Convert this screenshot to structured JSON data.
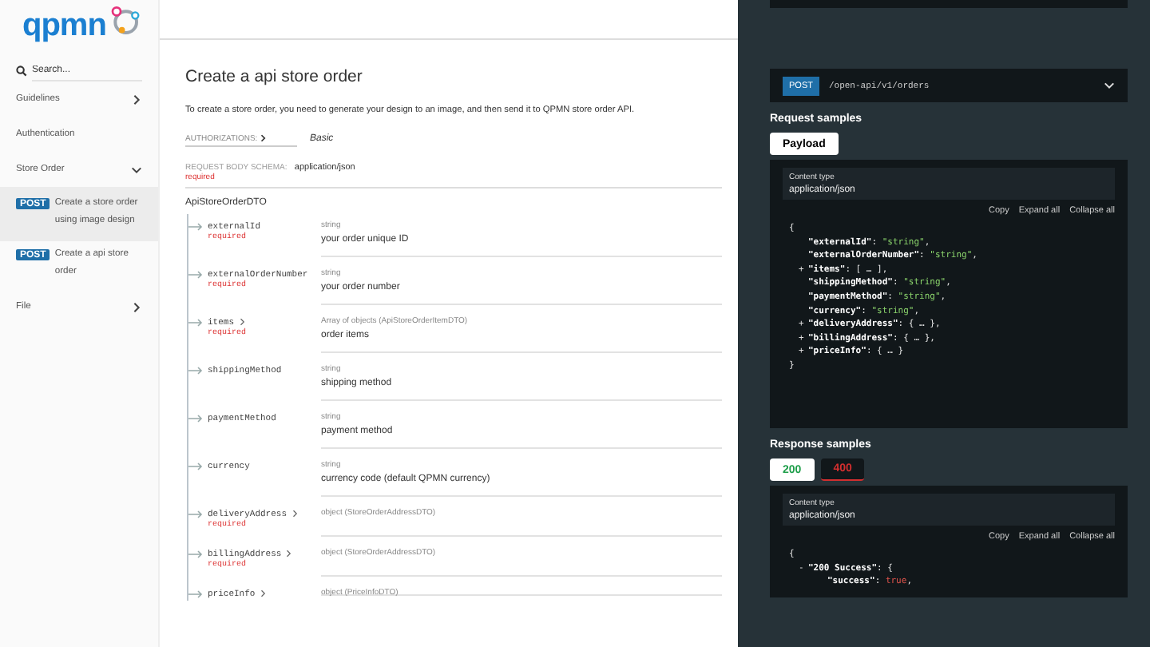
{
  "sidebar": {
    "logo": "qpmn",
    "search": {
      "placeholder": "Search..."
    },
    "items": [
      {
        "kind": "group",
        "label": "Guidelines",
        "expanded": false,
        "selected": false
      },
      {
        "kind": "link",
        "label": "Authentication",
        "selected": false
      },
      {
        "kind": "group",
        "label": "Store Order",
        "expanded": true,
        "selected": false
      },
      {
        "kind": "operation",
        "method": "POST",
        "label": "Create a store order using image design",
        "selected": true
      },
      {
        "kind": "operation",
        "method": "POST",
        "label": "Create a api store order",
        "selected": false
      },
      {
        "kind": "group",
        "label": "File",
        "expanded": false,
        "selected": false
      }
    ]
  },
  "main": {
    "title": "Create a api store order",
    "description": "To create a store order, you need to generate your design to an image, and then send it to QPMN store order API.",
    "authorizations": {
      "label": "AUTHORIZATIONS:",
      "value": "Basic"
    },
    "request_body": {
      "label": "REQUEST BODY SCHEMA:",
      "content_type": "application/json",
      "required": "required"
    },
    "schema_name": "ApiStoreOrderDTO",
    "fields": [
      {
        "name": "externalId",
        "expandable": false,
        "required": "required",
        "type": "string",
        "description": "your order unique ID"
      },
      {
        "name": "externalOrderNumber",
        "expandable": false,
        "required": "required",
        "type": "string",
        "description": "your order number"
      },
      {
        "name": "items",
        "expandable": true,
        "required": "required",
        "type": "Array of objects (ApiStoreOrderItemDTO)",
        "description": "order items"
      },
      {
        "name": "shippingMethod",
        "expandable": false,
        "type": "string",
        "description": "shipping method"
      },
      {
        "name": "paymentMethod",
        "expandable": false,
        "type": "string",
        "description": "payment method"
      },
      {
        "name": "currency",
        "expandable": false,
        "type": "string",
        "description": "currency code (default QPMN currency)"
      },
      {
        "name": "deliveryAddress",
        "expandable": true,
        "required": "required",
        "type": "object (StoreOrderAddressDTO)"
      },
      {
        "name": "billingAddress",
        "expandable": true,
        "required": "required",
        "type": "object (StoreOrderAddressDTO)"
      },
      {
        "name": "priceInfo",
        "expandable": true,
        "type": "object (PriceInfoDTO)"
      }
    ]
  },
  "samples": {
    "endpoint": {
      "method": "POST",
      "path": "/open-api/v1/orders"
    },
    "request": {
      "heading": "Request samples",
      "tabs": [
        {
          "label": "Payload",
          "selected": true
        }
      ],
      "content_type_label": "Content type",
      "content_type": "application/json",
      "actions": [
        "Copy",
        "Expand all",
        "Collapse all"
      ],
      "code": [
        {
          "parts": [
            {
              "kind": "punct",
              "text": "{"
            }
          ],
          "children": [
            {
              "parts": [
                {
                  "kind": "key",
                  "text": "\"externalId\""
                },
                {
                  "kind": "punct",
                  "text": ": "
                },
                {
                  "kind": "string",
                  "text": "\"string\""
                },
                {
                  "kind": "punct",
                  "text": ","
                }
              ]
            },
            {
              "parts": [
                {
                  "kind": "key",
                  "text": "\"externalOrderNumber\""
                },
                {
                  "kind": "punct",
                  "text": ": "
                },
                {
                  "kind": "string",
                  "text": "\"string\""
                },
                {
                  "kind": "punct",
                  "text": ","
                }
              ]
            },
            {
              "toggle": "+",
              "parts": [
                {
                  "kind": "key",
                  "text": "\"items\""
                },
                {
                  "kind": "punct",
                  "text": ": [ … ],"
                }
              ]
            },
            {
              "parts": [
                {
                  "kind": "key",
                  "text": "\"shippingMethod\""
                },
                {
                  "kind": "punct",
                  "text": ": "
                },
                {
                  "kind": "string",
                  "text": "\"string\""
                },
                {
                  "kind": "punct",
                  "text": ","
                }
              ]
            },
            {
              "parts": [
                {
                  "kind": "key",
                  "text": "\"paymentMethod\""
                },
                {
                  "kind": "punct",
                  "text": ": "
                },
                {
                  "kind": "string",
                  "text": "\"string\""
                },
                {
                  "kind": "punct",
                  "text": ","
                }
              ]
            },
            {
              "parts": [
                {
                  "kind": "key",
                  "text": "\"currency\""
                },
                {
                  "kind": "punct",
                  "text": ": "
                },
                {
                  "kind": "string",
                  "text": "\"string\""
                },
                {
                  "kind": "punct",
                  "text": ","
                }
              ]
            },
            {
              "toggle": "+",
              "parts": [
                {
                  "kind": "key",
                  "text": "\"deliveryAddress\""
                },
                {
                  "kind": "punct",
                  "text": ": { … },"
                }
              ]
            },
            {
              "toggle": "+",
              "parts": [
                {
                  "kind": "key",
                  "text": "\"billingAddress\""
                },
                {
                  "kind": "punct",
                  "text": ": { … },"
                }
              ]
            },
            {
              "toggle": "+",
              "parts": [
                {
                  "kind": "key",
                  "text": "\"priceInfo\""
                },
                {
                  "kind": "punct",
                  "text": ": { … }"
                }
              ]
            }
          ]
        },
        {
          "parts": [
            {
              "kind": "punct",
              "text": "}"
            }
          ]
        }
      ]
    },
    "response": {
      "heading": "Response samples",
      "tabs": [
        {
          "label": "200",
          "selected": true,
          "color": "#1e9e4a"
        },
        {
          "label": "400",
          "selected": false,
          "color": "#d32f2f"
        }
      ],
      "content_type_label": "Content type",
      "content_type": "application/json",
      "actions": [
        "Copy",
        "Expand all",
        "Collapse all"
      ],
      "code": [
        {
          "parts": [
            {
              "kind": "punct",
              "text": "{"
            }
          ],
          "children": [
            {
              "toggle": "-",
              "parts": [
                {
                  "kind": "key",
                  "text": "\"200 Success\""
                },
                {
                  "kind": "punct",
                  "text": ": {"
                }
              ],
              "children": [
                {
                  "parts": [
                    {
                      "kind": "key",
                      "text": "\"success\""
                    },
                    {
                      "kind": "punct",
                      "text": ": "
                    },
                    {
                      "kind": "bool",
                      "text": "true"
                    },
                    {
                      "kind": "punct",
                      "text": ","
                    }
                  ]
                }
              ]
            }
          ]
        }
      ]
    }
  }
}
